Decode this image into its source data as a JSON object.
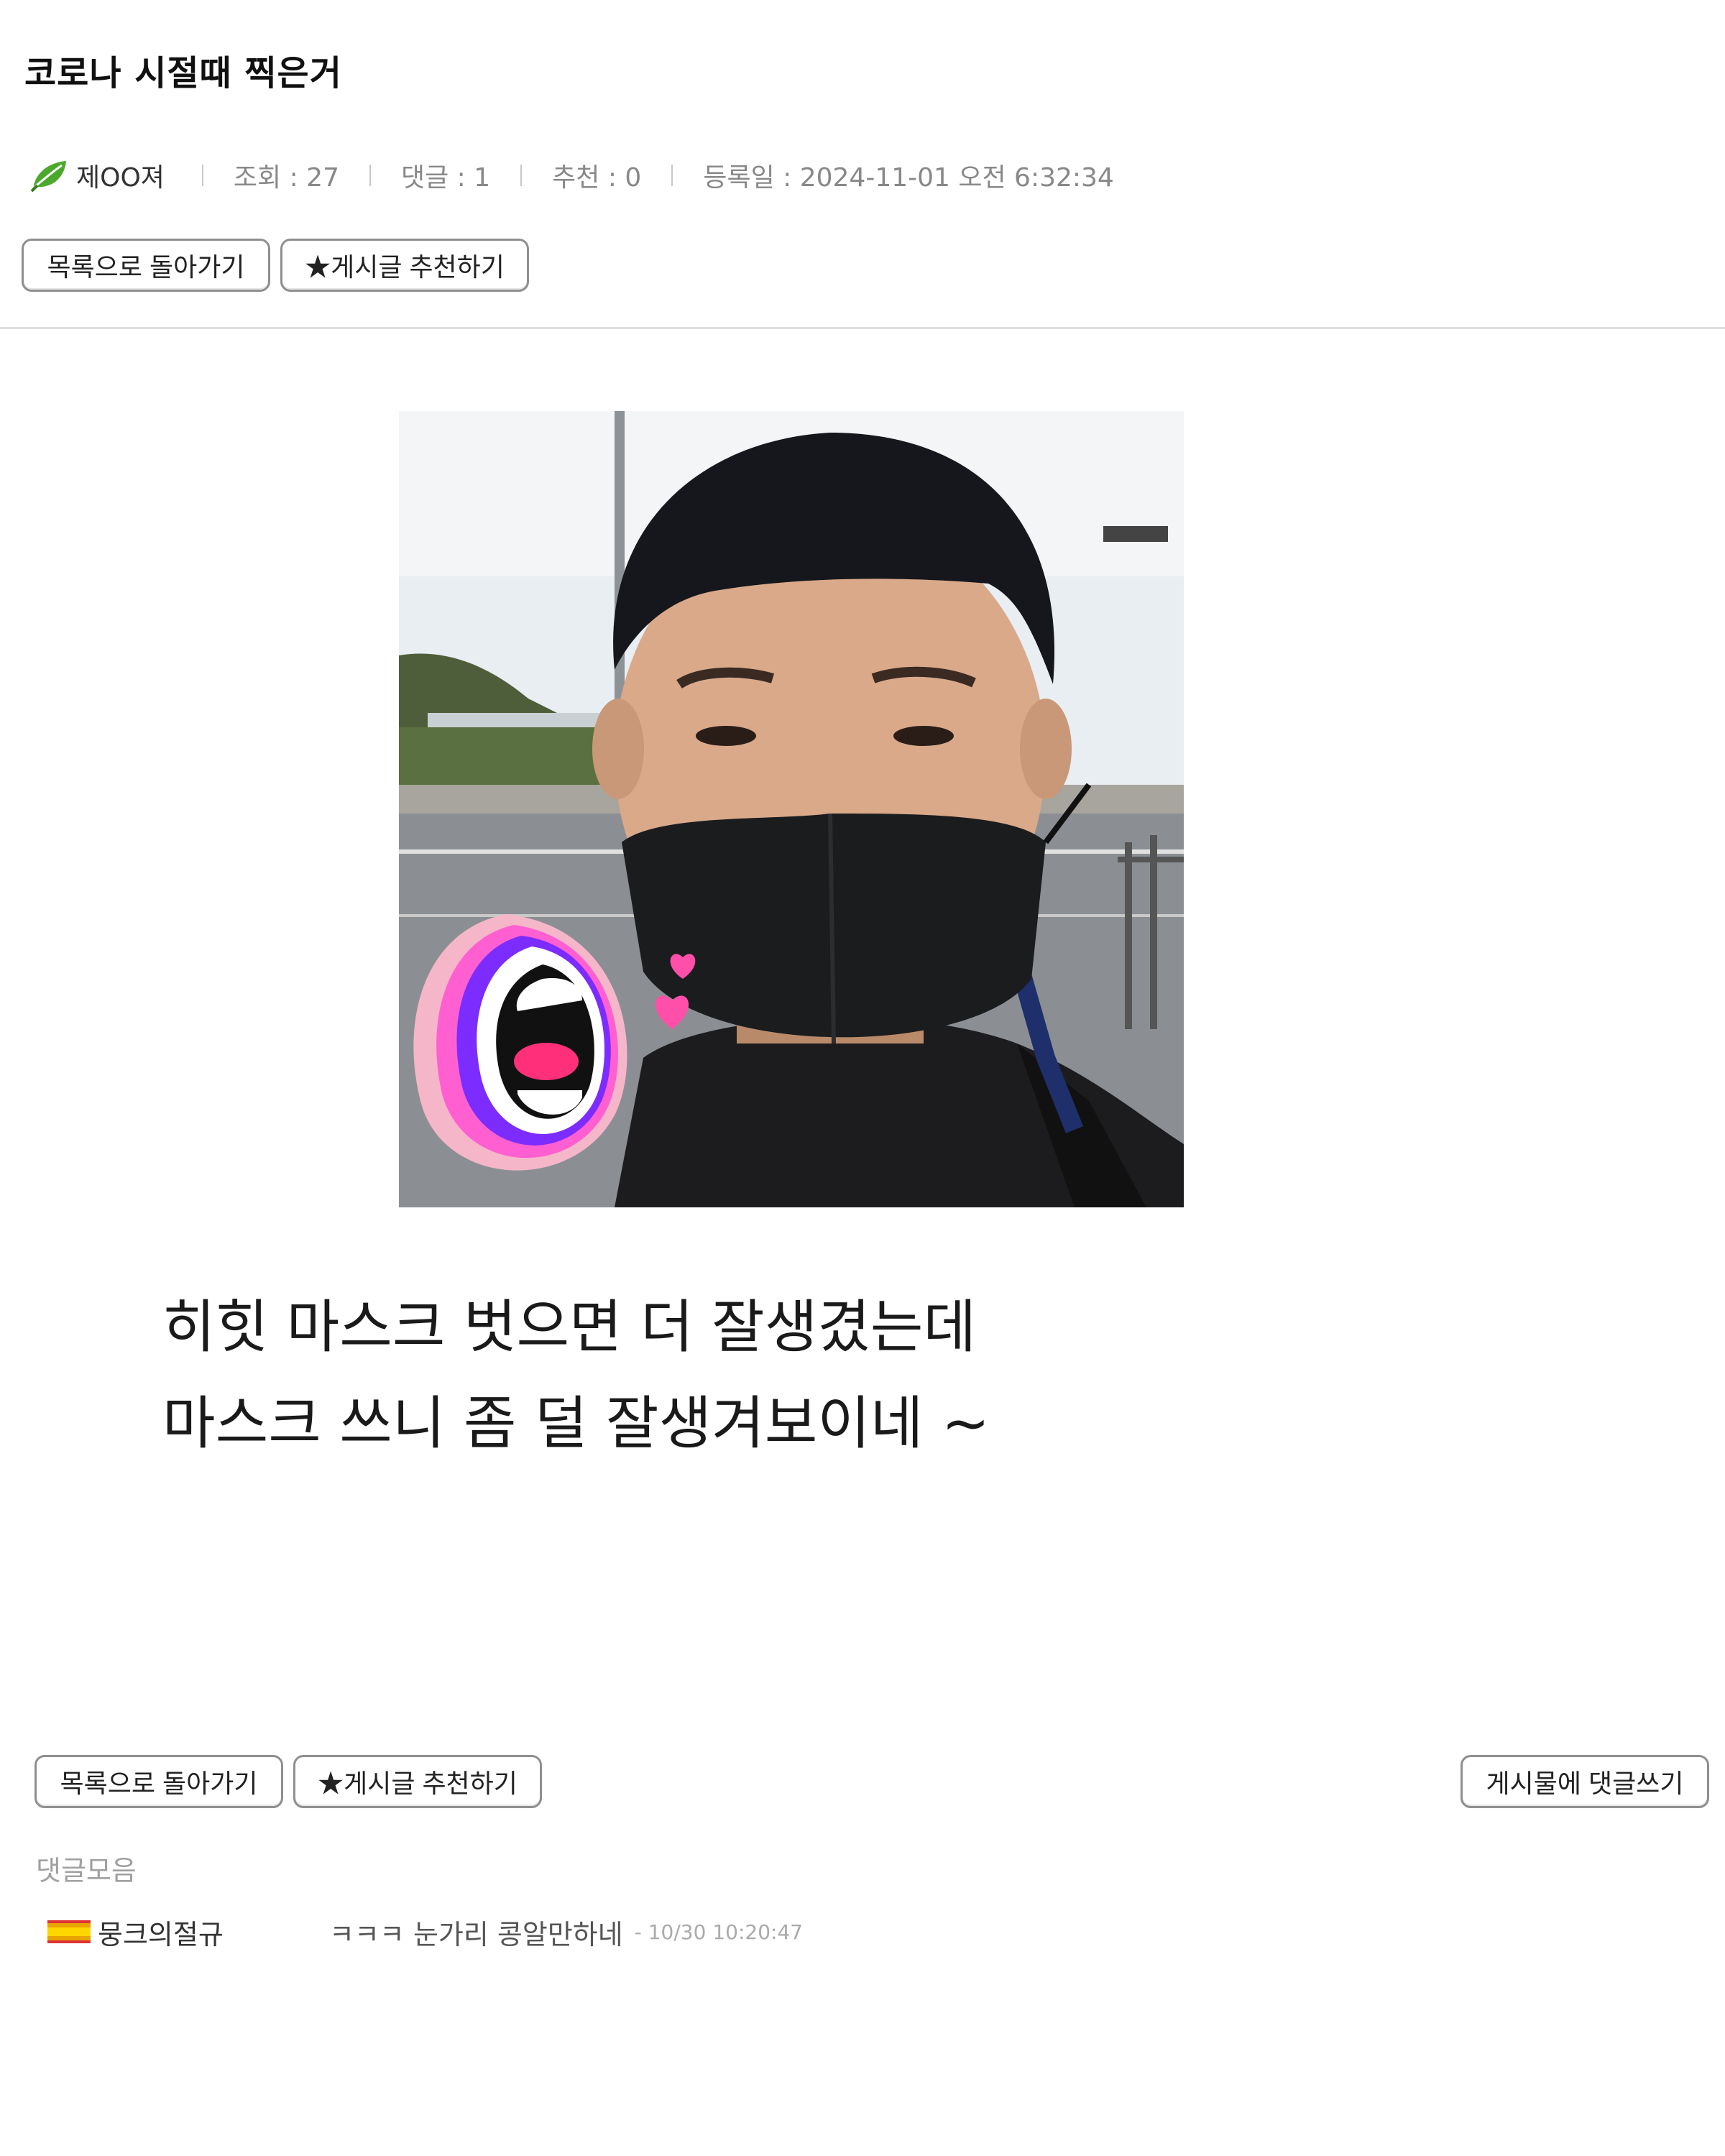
{
  "post": {
    "title": "코로나 시절때 찍은거",
    "author": "제OO져",
    "views_label": "조회 : 27",
    "comments_label": "댓글 : 1",
    "recommends_label": "추천 : 0",
    "date_label": "등록일 : 2024-11-01 오전 6:32:34",
    "body_lines": [
      "히힛 마스크 벗으면 더 잘생겼는데",
      "마스크 쓰니 좀 덜 잘생겨보이네 ~"
    ]
  },
  "buttons": {
    "back_to_list": "목록으로 돌아가기",
    "recommend": "★게시글 추천하기",
    "write_comment": "게시물에 댓글쓰기"
  },
  "comments": {
    "title": "댓글모음",
    "items": [
      {
        "author": "뭉크의절규",
        "text": "ㅋㅋㅋ 눈가리 콩알만하네",
        "time": "- 10/30 10:20:47"
      }
    ]
  },
  "icons": {
    "author_badge": "leaf-icon",
    "commenter_badge": "flag-icon"
  },
  "colors": {
    "leaf": "#4aa82a",
    "button_border": "#8f8f8f",
    "divider": "#dedede",
    "muted_text": "#888888"
  }
}
